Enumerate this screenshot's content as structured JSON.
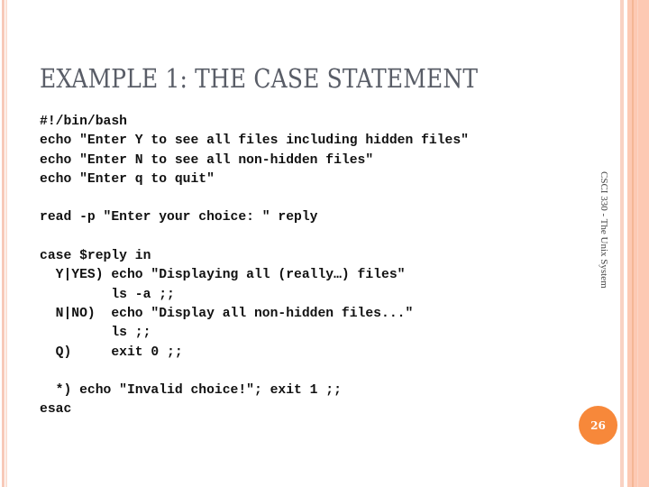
{
  "slide": {
    "title": "EXAMPLE 1: THE CASE STATEMENT",
    "code_lines": [
      "#!/bin/bash",
      "echo \"Enter Y to see all files including hidden files\"",
      "echo \"Enter N to see all non-hidden files\"",
      "echo \"Enter q to quit\"",
      "",
      "read -p \"Enter your choice: \" reply",
      "",
      "case $reply in",
      "  Y|YES) echo \"Displaying all (really…) files\"",
      "         ls -a ;;",
      "  N|NO)  echo \"Display all non-hidden files...\"",
      "         ls ;;",
      "  Q)     exit 0 ;;",
      "",
      "  *) echo \"Invalid choice!\"; exit 1 ;;",
      "esac"
    ],
    "footer_label": "CSCI 330 - The Unix System",
    "page_number": "26"
  },
  "colors": {
    "accent": "#f7883a",
    "border": "#fdc9b3",
    "title": "#595d67"
  }
}
